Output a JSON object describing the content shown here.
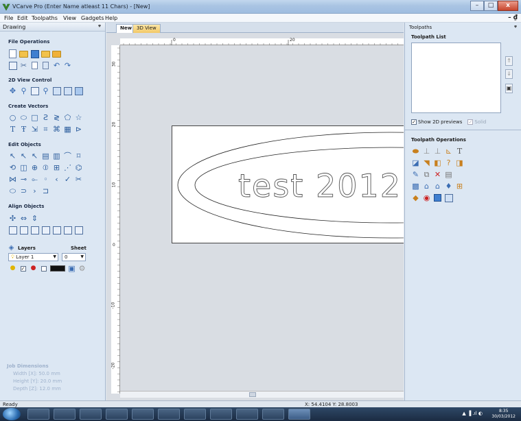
{
  "window": {
    "title": "VCarve Pro (Enter Name atleast 11 Chars) - [New]",
    "minimize": "–",
    "maximize": "□",
    "close": "x",
    "mdi_controls": "– ₫"
  },
  "menu": [
    "File",
    "Edit",
    "Toolpaths",
    "View",
    "Gadgets",
    "Help"
  ],
  "left_panel": {
    "title": "Drawing",
    "pin": "ᵠ",
    "sections": {
      "file_operations": "File Operations",
      "view_control": "2D View Control",
      "create_vectors": "Create Vectors",
      "edit_objects": "Edit Objects",
      "align_objects": "Align Objects"
    },
    "layers": {
      "title": "Layers",
      "sheet_label": "Sheet",
      "layer_value": "Layer 1",
      "sheet_value": "0"
    },
    "job_dimensions": {
      "title": "Job Dimensions",
      "width": "Width  [X]: 50.0 mm",
      "height": "Height [Y]: 20.0 mm",
      "depth": "Depth  [Z]: 12.0 mm"
    }
  },
  "tabs": [
    "New",
    "3D View"
  ],
  "canvas": {
    "ruler_top_labels": [
      "0",
      "20"
    ],
    "ruler_left_labels": [
      "30",
      "20",
      "10",
      "0",
      "-10",
      "-20"
    ],
    "text": "test 2012"
  },
  "right_panel": {
    "title": "Toolpaths",
    "pin": "ᵠ",
    "list_label": "Toolpath List",
    "show_2d": "Show 2D previews",
    "solid": "Solid",
    "operations_label": "Toolpath Operations"
  },
  "status": {
    "left": "Ready",
    "coords": "X: 54.4104 Y: 28.8003"
  },
  "taskbar": {
    "time": "8:35",
    "date": "30/03/2012"
  }
}
